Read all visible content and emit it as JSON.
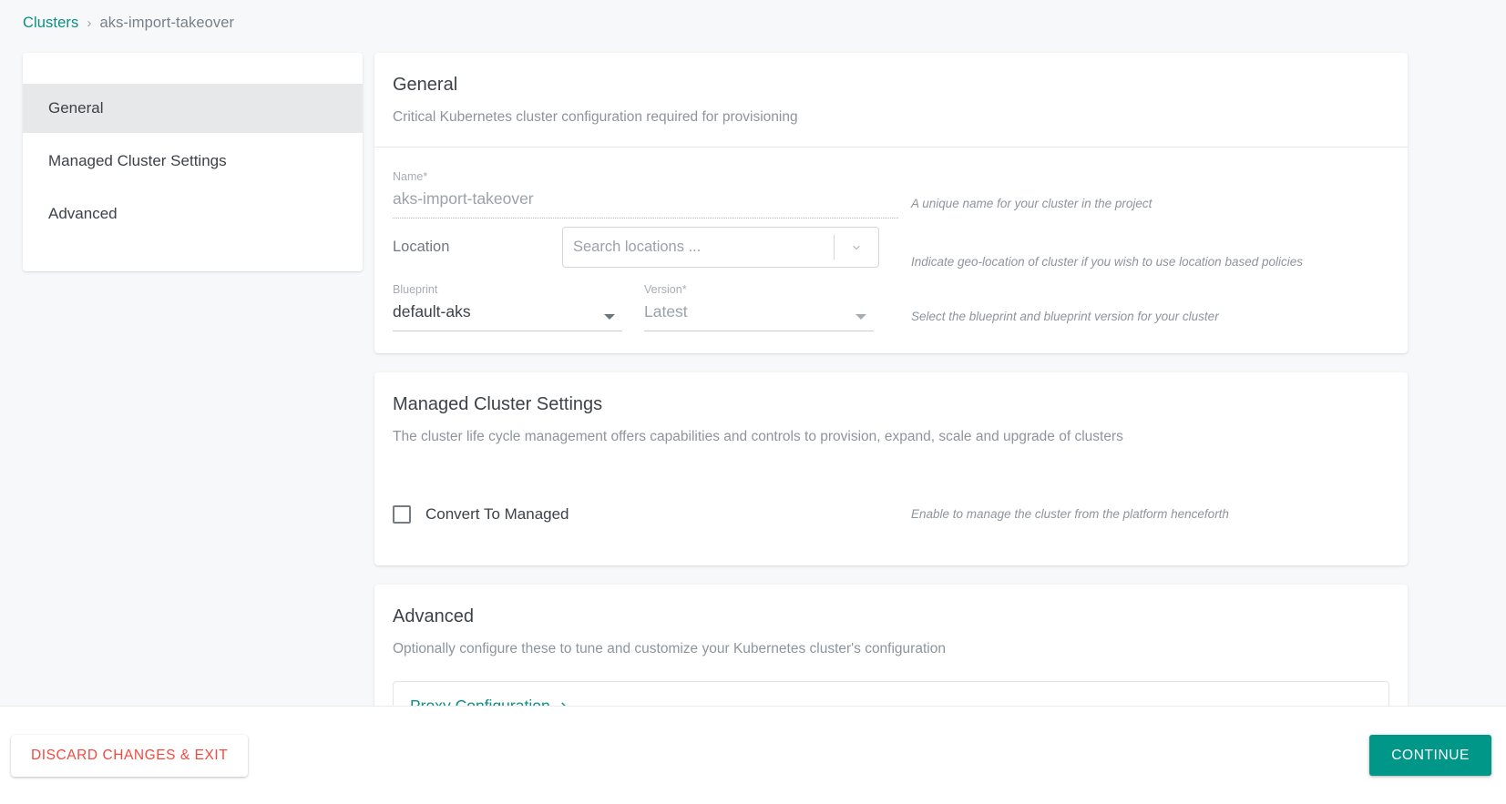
{
  "breadcrumb": {
    "root": "Clusters",
    "separator": "›",
    "current": "aks-import-takeover"
  },
  "colors": {
    "accent_teal": "#0a8f82",
    "primary_button": "#009688",
    "danger_text": "#f4493f",
    "page_background": "#f7f8fa",
    "card_background": "#ffffff",
    "nav_active_background": "#e7e8e9"
  },
  "sidebar": {
    "items": [
      {
        "label": "General",
        "active": true
      },
      {
        "label": "Managed Cluster Settings",
        "active": false
      },
      {
        "label": "Advanced",
        "active": false
      }
    ]
  },
  "general": {
    "title": "General",
    "subtitle": "Critical Kubernetes cluster configuration required for provisioning",
    "name_field": {
      "label": "Name",
      "required_mark": "*",
      "value": "aks-import-takeover",
      "hint": "A unique name for your cluster in the project"
    },
    "location_field": {
      "label": "Location",
      "placeholder": "Search locations ...",
      "hint": "Indicate geo-location of cluster if you wish to use location based policies",
      "chevron_icon": "chevron-down-icon"
    },
    "blueprint_field": {
      "label": "Blueprint",
      "value": "default-aks",
      "caret_icon": "caret-down-icon"
    },
    "version_field": {
      "label": "Version",
      "required_mark": "*",
      "value": "Latest",
      "caret_icon": "caret-down-icon"
    },
    "blueprint_hint": "Select the blueprint and blueprint version for your cluster"
  },
  "managed": {
    "title": "Managed Cluster Settings",
    "subtitle": "The cluster life cycle management offers capabilities and controls to provision, expand, scale and upgrade of clusters",
    "convert_checkbox": {
      "label": "Convert To Managed",
      "checked": false,
      "hint": "Enable to manage the cluster from the platform henceforth"
    }
  },
  "advanced": {
    "title": "Advanced",
    "subtitle": "Optionally configure these to tune and customize your Kubernetes cluster's configuration",
    "proxy_link": {
      "label": "Proxy Configuration",
      "arrow_icon": "chevron-right-icon"
    }
  },
  "footer": {
    "discard_label": "DISCARD CHANGES & EXIT",
    "continue_label": "CONTINUE"
  }
}
